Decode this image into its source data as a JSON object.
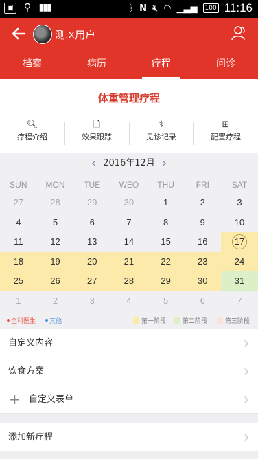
{
  "statusbar": {
    "time": "11:16",
    "battery": "100",
    "left_icons": [
      "photo-icon",
      "usb-icon",
      "barcode-icon"
    ],
    "right_icons": [
      "bluetooth-icon",
      "nfc-icon",
      "mute-icon",
      "wifi-icon",
      "signal-icon"
    ]
  },
  "appbar": {
    "title": "测.X用户"
  },
  "tabs": [
    {
      "label": "档案"
    },
    {
      "label": "病历"
    },
    {
      "label": "疗程",
      "active": true
    },
    {
      "label": "问诊"
    }
  ],
  "program": {
    "title": "体重管理疗程"
  },
  "actions": [
    {
      "label": "疗程介绍",
      "icon": "search-icon"
    },
    {
      "label": "效果跟踪",
      "icon": "document-icon"
    },
    {
      "label": "见诊记录",
      "icon": "stethoscope-icon"
    },
    {
      "label": "配置疗程",
      "icon": "add-box-icon"
    }
  ],
  "calendar": {
    "month": "2016年12月",
    "weekdays": [
      "SUN",
      "MON",
      "TUE",
      "WEO",
      "THU",
      "FRI",
      "SAT"
    ],
    "weeks": [
      [
        {
          "d": "27",
          "m": 1
        },
        {
          "d": "28",
          "m": 1
        },
        {
          "d": "29",
          "m": 1
        },
        {
          "d": "30",
          "m": 1
        },
        {
          "d": "1"
        },
        {
          "d": "2"
        },
        {
          "d": "3"
        }
      ],
      [
        {
          "d": "4"
        },
        {
          "d": "5"
        },
        {
          "d": "6"
        },
        {
          "d": "7"
        },
        {
          "d": "8"
        },
        {
          "d": "9"
        },
        {
          "d": "10"
        }
      ],
      [
        {
          "d": "11"
        },
        {
          "d": "12"
        },
        {
          "d": "13"
        },
        {
          "d": "14"
        },
        {
          "d": "15"
        },
        {
          "d": "16"
        },
        {
          "d": "17",
          "p": 1,
          "today": 1
        }
      ],
      [
        {
          "d": "18",
          "p": 1
        },
        {
          "d": "19",
          "p": 1
        },
        {
          "d": "20",
          "p": 1
        },
        {
          "d": "21",
          "p": 1
        },
        {
          "d": "22",
          "p": 1
        },
        {
          "d": "23",
          "p": 1
        },
        {
          "d": "24",
          "p": 1
        }
      ],
      [
        {
          "d": "25",
          "p": 1
        },
        {
          "d": "26",
          "p": 1
        },
        {
          "d": "27",
          "p": 1
        },
        {
          "d": "28",
          "p": 1
        },
        {
          "d": "29",
          "p": 1
        },
        {
          "d": "30",
          "p": 1
        },
        {
          "d": "31",
          "p": 2
        }
      ],
      [
        {
          "d": "1",
          "m": 1
        },
        {
          "d": "2",
          "m": 1
        },
        {
          "d": "3",
          "m": 1
        },
        {
          "d": "4",
          "m": 1
        },
        {
          "d": "5",
          "m": 1
        },
        {
          "d": "6",
          "m": 1
        },
        {
          "d": "7",
          "m": 1
        }
      ]
    ],
    "legend": {
      "general_doctor": "全科医生",
      "other": "其他",
      "phase1": "第一阶段",
      "phase2": "第二阶段",
      "phase3": "第三阶段"
    },
    "colors": {
      "phase1": "#fbeaa9",
      "phase2": "#dcefc6",
      "phase3": "#fbe2e0",
      "doctor": "#e8534a",
      "other": "#4f8fd8"
    }
  },
  "menu1": [
    {
      "label": "自定义内容"
    },
    {
      "label": "饮食方案"
    },
    {
      "label": "自定义表单",
      "plus": true
    }
  ],
  "menu2": [
    {
      "label": "添加新疗程"
    }
  ]
}
